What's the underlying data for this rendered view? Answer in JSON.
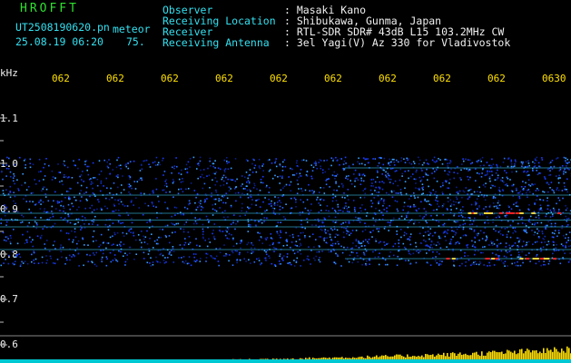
{
  "header": {
    "title": "HROFFT",
    "filename": "UT2508190620.pn",
    "mode": "meteor",
    "datetime": "25.08.19 06:20",
    "count": "75.",
    "fields": [
      {
        "label": "Observer",
        "value": ": Masaki Kano"
      },
      {
        "label": "Receiving Location",
        "value": ": Shibukawa, Gunma, Japan"
      },
      {
        "label": "Receiver",
        "value": ": RTL-SDR SDR# 43dB L15 103.2MHz CW"
      },
      {
        "label": "Receiving Antenna",
        "value": ": 3el Yagi(V) Az 330 for Vladivostok"
      }
    ]
  },
  "chart_data": {
    "type": "heatmap",
    "ylabel": "kHz",
    "y_ticks": [
      "1.1",
      "1.0",
      "0.9",
      "0.8",
      "0.7",
      "0.6"
    ],
    "ylim": [
      0.6,
      1.1
    ],
    "x_ticks": [
      "062",
      "062",
      "062",
      "062",
      "062",
      "062",
      "062",
      "062",
      "062",
      "0630"
    ],
    "noise_band_khz": [
      0.775,
      1.015
    ],
    "signal_lines_khz": [
      0.79,
      0.81,
      0.86,
      0.875,
      0.89,
      0.93,
      0.99
    ]
  },
  "colors": {
    "background": "#000000",
    "title": "#2fe02f",
    "header_label": "#33e0f0",
    "header_value": "#f0f0f0",
    "time_tick": "#ffe000",
    "noise": "#1a3cff",
    "signal": "#ff2020",
    "baseline_bars": "#ffe000"
  }
}
